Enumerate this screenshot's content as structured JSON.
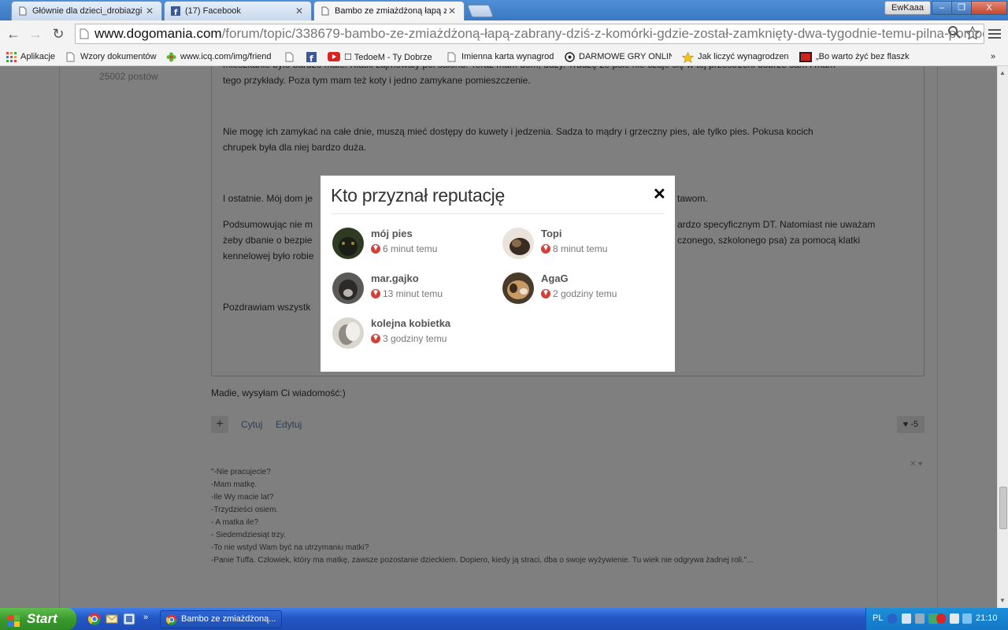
{
  "browser": {
    "tabs": [
      {
        "title": "Głównie dla dzieci_drobiazgi",
        "icon": "page-icon",
        "active": false
      },
      {
        "title": "(17) Facebook",
        "icon": "facebook-icon",
        "active": false
      },
      {
        "title": "Bambo ze zmiażdżoną łapą z",
        "icon": "page-icon",
        "active": true
      }
    ],
    "tab_close_glyph": "✕",
    "user_name": "EwKaaa",
    "window_buttons": {
      "minimize": "–",
      "maximize": "❐",
      "close": "X"
    },
    "url_host": "www.dogomania.com",
    "url_path": "/forum/topic/338679-bambo-ze-zmiażdżoną-łapą-zabrany-dziś-z-komórki-gdzie-został-zamknięty-dwa-tygodnie-temu-pilna-pomoc-",
    "bookmarks": [
      {
        "label": "Aplikacje",
        "icon": "apps-icon"
      },
      {
        "label": "Wzory dokumentów",
        "icon": "page-icon"
      },
      {
        "label": "www.icq.com/img/friend",
        "icon": "icq-flower-icon"
      },
      {
        "label": "",
        "icon": "page-icon"
      },
      {
        "label": "",
        "icon": "facebook-icon"
      },
      {
        "label": "☐ TedoeM - Ty Dobrze",
        "icon": "youtube-icon"
      },
      {
        "label": "Imienna karta wynagrod",
        "icon": "page-icon"
      },
      {
        "label": "DARMOWE GRY ONLINE",
        "icon": "globe-icon"
      },
      {
        "label": "Jak liczyć wynagrodzenie",
        "icon": "star-icon"
      },
      {
        "label": "„Bo warto żyć bez flaszk",
        "icon": "news-icon"
      }
    ],
    "bookmarks_more": "»"
  },
  "post": {
    "user_posts": "25002 postów",
    "paragraphs": [
      "mieszkanie było bardzo małe. Klatki zajmowały pół salonu. Teraz mam dom, duży. Trudzę że psie nie czuje się w tej przestrzeni dobrze sam i mam",
      "tego przykłady. Poza tym mam też koty i jedno zamykane pomieszczenie.",
      "Nie mogę ich zamykać na całe dnie, muszą mieć dostępy do kuwety i jedzenia. Sadza to mądry i grzeczny pies, ale tylko pies. Pokusa kocich",
      "chrupek była dla niej bardzo duża.",
      "I ostatnie. Mój dom je",
      "tawom.",
      "Podsumowując nie m",
      "ardzo specyficznym DT. Natomiast nie uważam",
      "żeby dbanie o bezpie",
      "czonego, szkolonego psa) za pomocą klatki",
      "kennelowej było robie",
      "Pozdrawiam wszystk"
    ],
    "after_text": "Madie, wysyłam Ci wiadomość:)",
    "actions": {
      "plus": "+",
      "quote": "Cytuj",
      "edit": "Edytuj",
      "reputation": "♥ -5"
    },
    "signature": [
      "\"-Nie pracujecie?",
      "-Mam matkę.",
      "-Ile Wy macie lat?",
      "-Trzydzieści osiem.",
      "- A matka ile?",
      "- Siedemdziesiąt trzy.",
      "-To nie wstyd Wam być na utrzymaniu matki?",
      "-Panie Tuffa. Człowiek, który ma matkę, zawsze pozostanie dzieckiem. Dopiero, kiedy ją straci, dba o swoje wyżywienie. Tu wiek nie odgrywa żadnej roli.\"..."
    ],
    "signature_tools": "✕ ▾"
  },
  "modal": {
    "title": "Kto przyznał reputację",
    "close_glyph": "✕",
    "entries": [
      {
        "name": "mój pies",
        "time": "6 minut temu",
        "avatar_color": "#2f3a22"
      },
      {
        "name": "Topi",
        "time": "8 minut temu",
        "avatar_color": "#6b5a4a"
      },
      {
        "name": "mar.gajko",
        "time": "13 minut temu",
        "avatar_color": "#4b4a48"
      },
      {
        "name": "AgaG",
        "time": "2 godziny temu",
        "avatar_color": "#7a5634"
      },
      {
        "name": "kolejna kobietka",
        "time": "3 godziny temu",
        "avatar_color": "#cfcac3"
      }
    ]
  },
  "taskbar": {
    "start_label": "Start",
    "task_item": "Bambo ze zmiażdżoną...",
    "language": "PL",
    "clock": "21:10",
    "quicklaunch_more": "»"
  }
}
